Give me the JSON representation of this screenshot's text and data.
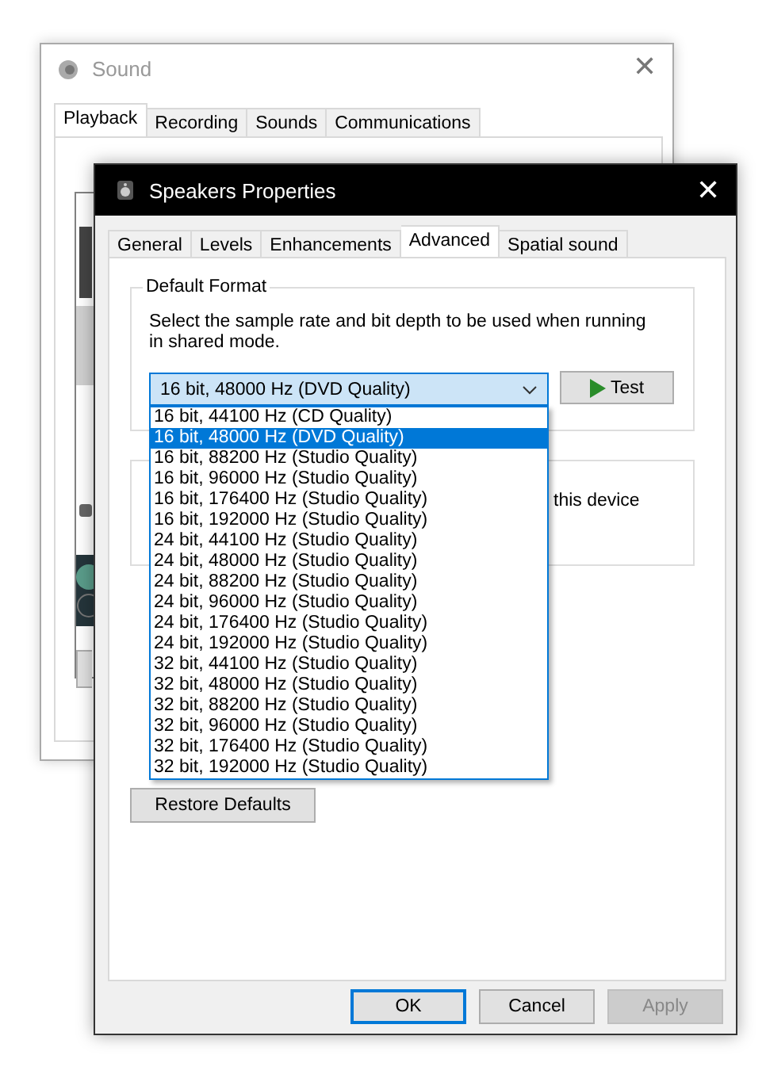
{
  "sound_window": {
    "title": "Sound",
    "tabs": [
      {
        "label": "Playback",
        "selected": true
      },
      {
        "label": "Recording",
        "selected": false
      },
      {
        "label": "Sounds",
        "selected": false
      },
      {
        "label": "Communications",
        "selected": false
      }
    ],
    "close": "✕"
  },
  "properties_window": {
    "title": "Speakers Properties",
    "close": "✕",
    "tabs": [
      {
        "label": "General",
        "selected": false
      },
      {
        "label": "Levels",
        "selected": false
      },
      {
        "label": "Enhancements",
        "selected": false
      },
      {
        "label": "Advanced",
        "selected": true
      },
      {
        "label": "Spatial sound",
        "selected": false
      }
    ],
    "default_format": {
      "legend": "Default Format",
      "description": "Select the sample rate and bit depth to be used when running in shared mode.",
      "combo_value": "16 bit, 48000 Hz (DVD Quality)",
      "test_button": "Test",
      "options": [
        {
          "label": "16 bit, 44100 Hz (CD Quality)",
          "selected": false
        },
        {
          "label": "16 bit, 48000 Hz (DVD Quality)",
          "selected": true
        },
        {
          "label": "16 bit, 88200 Hz (Studio Quality)",
          "selected": false
        },
        {
          "label": "16 bit, 96000 Hz (Studio Quality)",
          "selected": false
        },
        {
          "label": "16 bit, 176400 Hz (Studio Quality)",
          "selected": false
        },
        {
          "label": "16 bit, 192000 Hz (Studio Quality)",
          "selected": false
        },
        {
          "label": "24 bit, 44100 Hz (Studio Quality)",
          "selected": false
        },
        {
          "label": "24 bit, 48000 Hz (Studio Quality)",
          "selected": false
        },
        {
          "label": "24 bit, 88200 Hz (Studio Quality)",
          "selected": false
        },
        {
          "label": "24 bit, 96000 Hz (Studio Quality)",
          "selected": false
        },
        {
          "label": "24 bit, 176400 Hz (Studio Quality)",
          "selected": false
        },
        {
          "label": "24 bit, 192000 Hz (Studio Quality)",
          "selected": false
        },
        {
          "label": "32 bit, 44100 Hz (Studio Quality)",
          "selected": false
        },
        {
          "label": "32 bit, 48000 Hz (Studio Quality)",
          "selected": false
        },
        {
          "label": "32 bit, 88200 Hz (Studio Quality)",
          "selected": false
        },
        {
          "label": "32 bit, 96000 Hz (Studio Quality)",
          "selected": false
        },
        {
          "label": "32 bit, 176400 Hz (Studio Quality)",
          "selected": false
        },
        {
          "label": "32 bit, 192000 Hz (Studio Quality)",
          "selected": false
        }
      ]
    },
    "exclusive_mode": {
      "option_text": "this device"
    },
    "restore_button": "Restore Defaults",
    "buttons": [
      {
        "label": "OK",
        "default": true,
        "disabled": false
      },
      {
        "label": "Cancel",
        "default": false,
        "disabled": false
      },
      {
        "label": "Apply",
        "default": false,
        "disabled": true
      }
    ]
  }
}
